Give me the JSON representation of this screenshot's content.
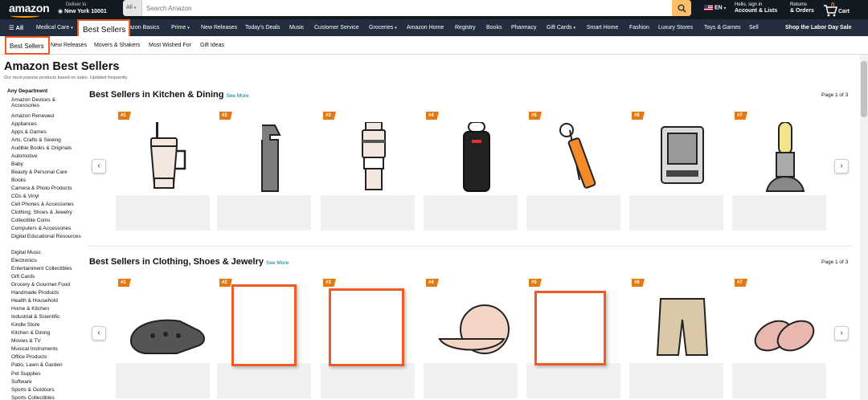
{
  "header": {
    "logo": "amazon",
    "deliver_line1": "Deliver to",
    "deliver_line2": "New York 10001",
    "search_category": "All",
    "search_placeholder": "Search Amazon",
    "lang": "EN",
    "account_line1": "Hello, sign in",
    "account_line2": "Account & Lists",
    "returns_line1": "Returns",
    "returns_line2": "& Orders",
    "cart_count": "0",
    "cart_label": "Cart"
  },
  "nav": {
    "all": "All",
    "items": [
      "Medical Care",
      "Best Sellers",
      "Amazon Basics",
      "Prime",
      "New Releases",
      "Today's Deals",
      "Music",
      "Customer Service",
      "Groceries",
      "Amazon Home",
      "Registry",
      "Books",
      "Pharmacy",
      "Gift Cards",
      "Smart Home",
      "Fashion",
      "Luxury Stores",
      "Toys & Games",
      "Sell"
    ],
    "promo": "Shop the Labor Day Sale"
  },
  "subnav": {
    "items": [
      "Best Sellers",
      "New Releases",
      "Movers & Shakers",
      "Most Wished For",
      "Gift Ideas"
    ]
  },
  "page": {
    "title": "Amazon Best Sellers",
    "subtitle": "Our most popular products based on sales. Updated frequently."
  },
  "sidebar": {
    "heading": "Any Department",
    "items": [
      "Amazon Devices & Accessories",
      "Amazon Renewed",
      "Appliances",
      "Apps & Games",
      "Arts, Crafts & Sewing",
      "Audible Books & Originals",
      "Automotive",
      "Baby",
      "Beauty & Personal Care",
      "Books",
      "Camera & Photo Products",
      "CDs & Vinyl",
      "Cell Phones & Accessories",
      "Clothing, Shoes & Jewelry",
      "Collectible Coins",
      "Computers & Accessories",
      "Digital Educational Resources",
      "Digital Music",
      "Electronics",
      "Entertainment Collectibles",
      "Gift Cards",
      "Grocery & Gourmet Food",
      "Handmade Products",
      "Health & Household",
      "Home & Kitchen",
      "Industrial & Scientific",
      "Kindle Store",
      "Kitchen & Dining",
      "Movies & TV",
      "Musical Instruments",
      "Office Products",
      "Patio, Lawn & Garden",
      "Pet Supplies",
      "Software",
      "Sports & Outdoors",
      "Sports Collectibles"
    ]
  },
  "sections": [
    {
      "title": "Best Sellers in Kitchen & Dining",
      "see_more": "See More",
      "page": "Page 1 of 3",
      "ranks": [
        "#1",
        "#2",
        "#3",
        "#4",
        "#5",
        "#6",
        "#7"
      ]
    },
    {
      "title": "Best Sellers in Clothing, Shoes & Jewelry",
      "see_more": "See More",
      "page": "Page 1 of 3",
      "ranks": [
        "#1",
        "#2",
        "#3",
        "#4",
        "#5",
        "#6",
        "#7"
      ]
    }
  ],
  "colors": {
    "topbar": "#131921",
    "navbar": "#232f3e",
    "accent": "#ff9900",
    "badge": "#e47911",
    "highlight": "#f05a24",
    "link": "#007185"
  }
}
